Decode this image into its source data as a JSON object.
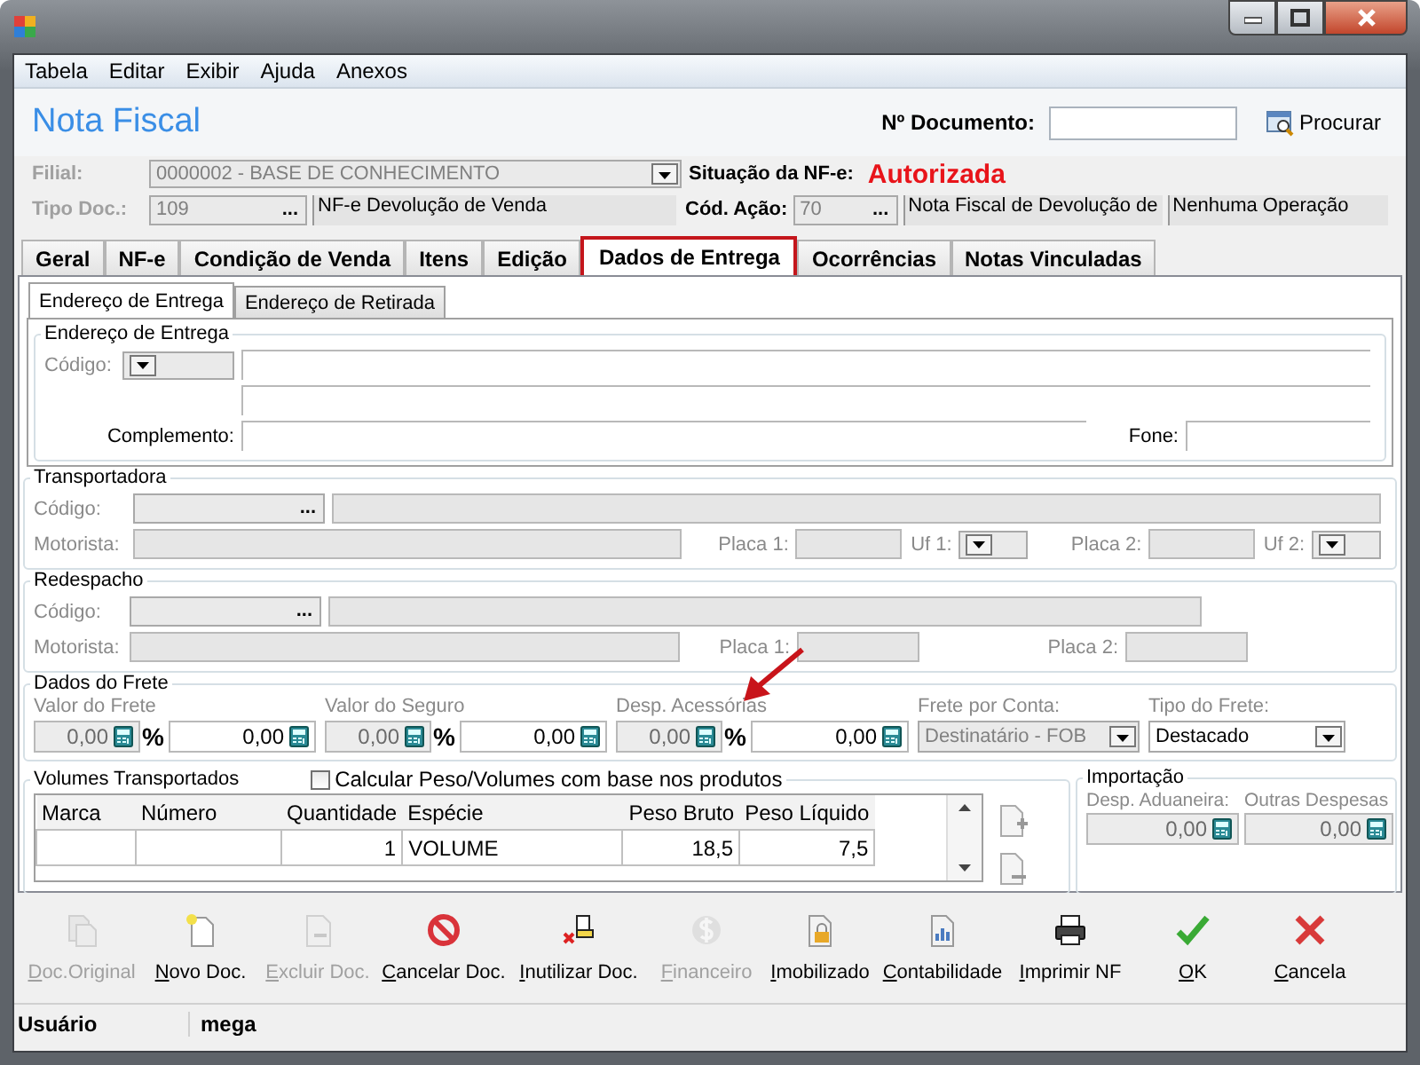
{
  "menu": [
    "Tabela",
    "Editar",
    "Exibir",
    "Ajuda",
    "Anexos"
  ],
  "header": {
    "title": "Nota Fiscal",
    "document_label": "Nº Documento:",
    "search_button": "Procurar"
  },
  "filial": {
    "label": "Filial:",
    "value": "0000002 - BASE DE CONHECIMENTO"
  },
  "status": {
    "label": "Situação da NF-e:",
    "value": "Autorizada"
  },
  "tipo_doc": {
    "label": "Tipo Doc.:",
    "code": "109",
    "lookup": "...",
    "description": "NF-e Devolução de Venda"
  },
  "cod_acao": {
    "label": "Cód. Ação:",
    "code": "70",
    "lookup": "...",
    "description": "Nota Fiscal de Devolução de",
    "operation": "Nenhuma Operação"
  },
  "tabs": [
    {
      "label": "Geral",
      "selected": false
    },
    {
      "label": "NF-e",
      "selected": false
    },
    {
      "label": "Condição de Venda",
      "selected": false
    },
    {
      "label": "Itens",
      "selected": false
    },
    {
      "label": "Edição",
      "selected": false
    },
    {
      "label": "Dados de Entrega",
      "selected": true
    },
    {
      "label": "Ocorrências",
      "selected": false
    },
    {
      "label": "Notas Vinculadas",
      "selected": false
    }
  ],
  "subtabs": [
    {
      "label": "Endereço de Entrega",
      "selected": true
    },
    {
      "label": "Endereço de Retirada",
      "selected": false
    }
  ],
  "entrega": {
    "title": "Endereço de Entrega",
    "code_label": "Código:",
    "complement_label": "Complemento:",
    "phone_label": "Fone:"
  },
  "transportadora": {
    "title": "Transportadora",
    "code_label": "Código:",
    "lookup": "...",
    "driver_label": "Motorista:",
    "plates": [
      {
        "label": "Placa 1:",
        "uf_label": "Uf 1:"
      },
      {
        "label": "Placa 2:",
        "uf_label": "Uf 2:"
      }
    ]
  },
  "redespacho": {
    "title": "Redespacho",
    "code_label": "Código:",
    "lookup": "...",
    "driver_label": "Motorista:",
    "plates": [
      {
        "label": "Placa 1:"
      },
      {
        "label": "Placa 2:"
      }
    ]
  },
  "frete": {
    "title": "Dados do Frete",
    "values": [
      {
        "label": "Valor do Frete",
        "value": "0,00",
        "unit": "%",
        "amount": "0,00"
      },
      {
        "label": "Valor do Seguro",
        "value": "0,00",
        "unit": "%",
        "amount": "0,00"
      },
      {
        "label": "Desp. Acessórias",
        "value": "0,00",
        "unit": "%",
        "amount": "0,00"
      }
    ],
    "payer": {
      "label": "Frete por Conta:",
      "value": "Destinatário - FOB"
    },
    "type": {
      "label": "Tipo do Frete:",
      "value": "Destacado"
    }
  },
  "volumes": {
    "title": "Volumes Transportados",
    "calculate": {
      "label": "Calcular Peso/Volumes com base nos produtos",
      "checked": false
    },
    "columns": [
      "Marca",
      "Número",
      "Quantidade",
      "Espécie",
      "Peso Bruto",
      "Peso Líquido"
    ],
    "rows": [
      {
        "quantity": "1",
        "species": "VOLUME",
        "gross_weight": "18,5",
        "net_weight": "7,5"
      }
    ]
  },
  "importacao": {
    "title": "Importação",
    "values": [
      {
        "label": "Desp. Aduaneira:",
        "value": "0,00"
      },
      {
        "label": "Outras Despesas",
        "value": "0,00"
      }
    ]
  },
  "toolbar": [
    {
      "label": "Doc.Original",
      "disabled": true
    },
    {
      "label": "Novo Doc.",
      "disabled": false
    },
    {
      "label": "Excluir Doc.",
      "disabled": true
    },
    {
      "label": "Cancelar Doc.",
      "disabled": false
    },
    {
      "label": "Inutilizar Doc.",
      "disabled": false
    },
    {
      "label": "Financeiro",
      "disabled": true
    },
    {
      "label": "Imobilizado",
      "disabled": false
    },
    {
      "label": "Contabilidade",
      "disabled": false
    },
    {
      "label": "Imprimir NF",
      "disabled": false
    },
    {
      "label": "OK",
      "disabled": false
    },
    {
      "label": "Cancela",
      "disabled": false
    }
  ],
  "status_bar": [
    "Usuário",
    "mega"
  ]
}
